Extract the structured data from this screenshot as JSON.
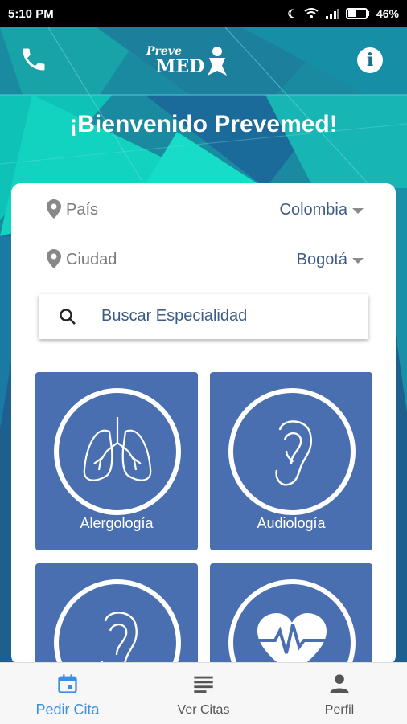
{
  "status_bar": {
    "time": "5:10 PM",
    "battery": "46%"
  },
  "header": {
    "logo_text": "Preve MED",
    "welcome": "¡Bienvenido Prevemed!"
  },
  "filters": {
    "country": {
      "label": "País",
      "value": "Colombia"
    },
    "city": {
      "label": "Ciudad",
      "value": "Bogotá"
    }
  },
  "search": {
    "placeholder": "Buscar Especialidad"
  },
  "specialties": [
    {
      "name": "Alergología",
      "icon": "lungs-icon"
    },
    {
      "name": "Audiología",
      "icon": "ear-icon"
    },
    {
      "name": "",
      "icon": "ear-icon"
    },
    {
      "name": "",
      "icon": "heart-pulse-icon"
    }
  ],
  "bottom_nav": {
    "items": [
      {
        "label": "Pedir Cita",
        "icon": "calendar-icon",
        "active": true
      },
      {
        "label": "Ver Citas",
        "icon": "list-icon",
        "active": false
      },
      {
        "label": "Perfil",
        "icon": "person-icon",
        "active": false
      }
    ]
  },
  "colors": {
    "accent": "#3b8ee0",
    "tile": "#4a6fb0",
    "value_text": "#3c5b86",
    "teal": "#17c6c0"
  }
}
